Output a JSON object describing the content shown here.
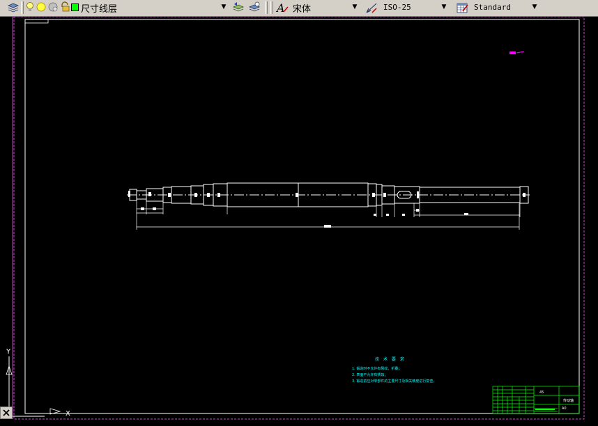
{
  "toolbar": {
    "layer": {
      "name": "尺寸线层",
      "color": "#00ff00"
    },
    "text_style": "宋体",
    "dim_style": "ISO-25",
    "table_style": "Standard"
  },
  "drawing": {
    "tech_requirements": {
      "title": "技 术 要 求",
      "items": [
        "1. 锻造时不允许有裂纹、折叠；",
        "2. 表面不允许有锈蚀；",
        "3. 锻造前应对零部件的主要尺寸及相关精度进行复查。"
      ]
    },
    "title_block": {
      "material": "45",
      "part_name": "传动轴",
      "sheet_size": "A0"
    }
  },
  "colors": {
    "background": "#000000",
    "lines": "#ffffff",
    "frame": "#cc44cc",
    "text": "#00ffff",
    "title_block": "#00ff00",
    "accent": "#ff00ff"
  },
  "icons": {
    "layer_manager": "layers-icon",
    "bulb": "lightbulb-icon",
    "sun": "sun-icon",
    "freeze": "freeze-icon",
    "lock": "lock-icon",
    "layer_prev": "layer-previous-icon",
    "layer_states": "layer-states-icon",
    "text_style": "text-style-icon",
    "dim_style": "dim-style-icon",
    "table_style": "table-style-icon",
    "ucs": "ucs-icon",
    "close": "close-icon"
  }
}
